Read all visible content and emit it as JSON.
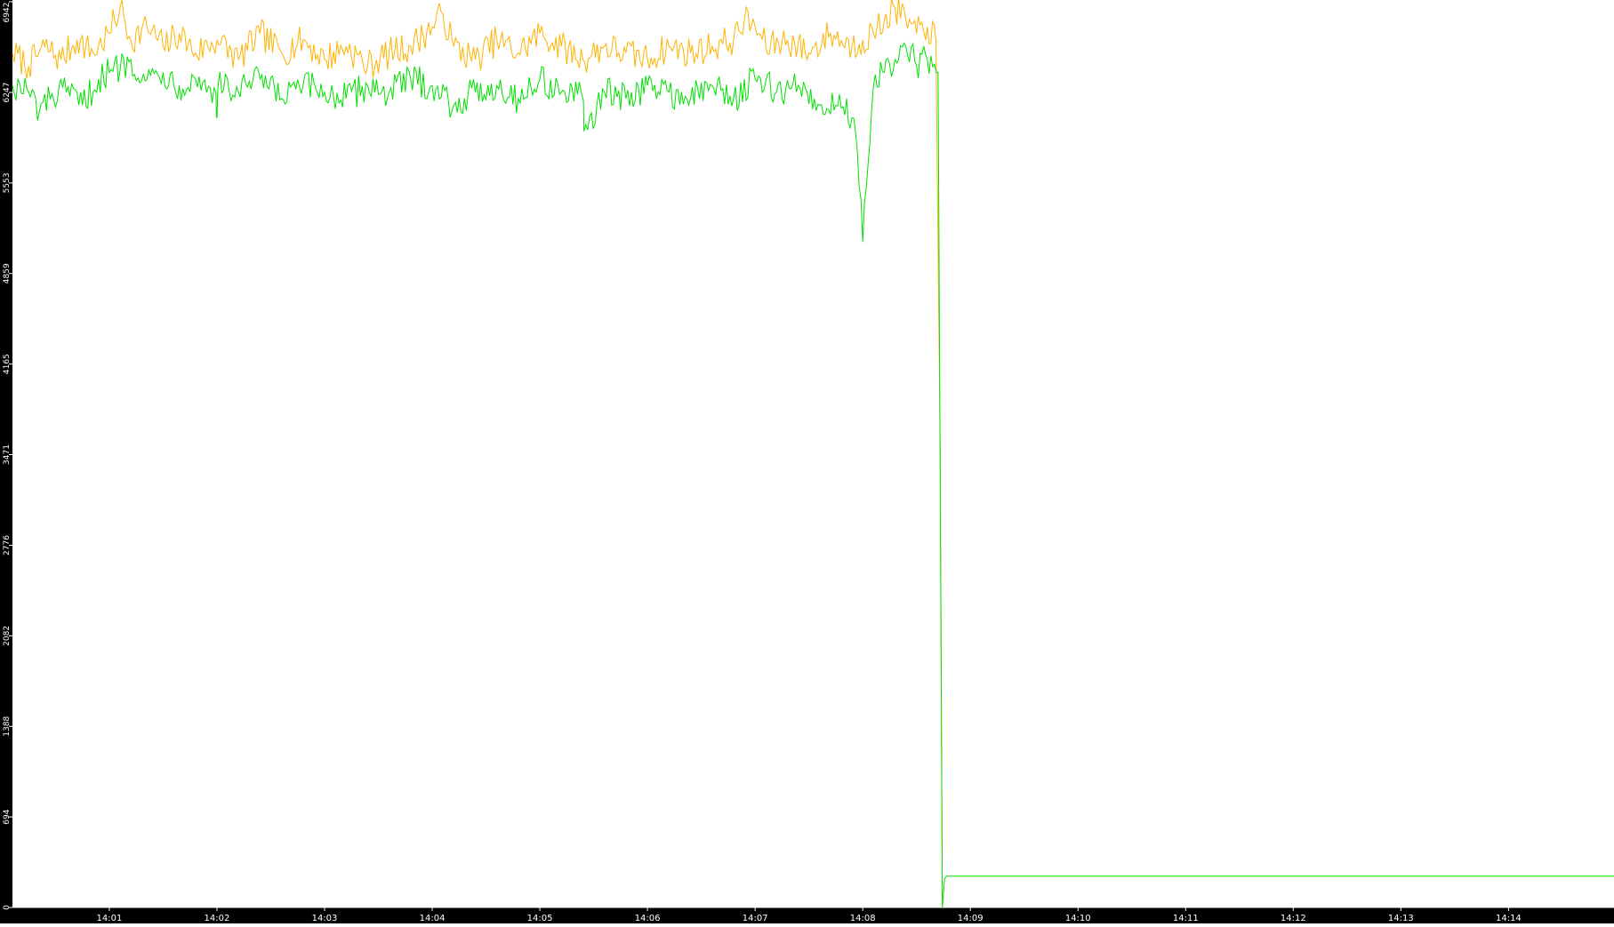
{
  "chart_data": {
    "type": "line",
    "title": "",
    "xlabel": "",
    "ylabel": "",
    "x_tick_labels": [
      "14:01",
      "14:02",
      "14:03",
      "14:04",
      "14:05",
      "14:06",
      "14:07",
      "14:08",
      "14:09",
      "14:10",
      "14:11",
      "14:12",
      "14:13",
      "14:14"
    ],
    "x_tick_minutes": [
      1,
      2,
      3,
      4,
      5,
      6,
      7,
      8,
      9,
      10,
      11,
      12,
      13,
      14
    ],
    "x_range_minutes": [
      0.1,
      14.98
    ],
    "y_tick_labels": [
      "0",
      "694",
      "1388",
      "2082",
      "2776",
      "3471",
      "4165",
      "4859",
      "5553",
      "6247",
      "6942"
    ],
    "y_tick_values": [
      0,
      694,
      1388,
      2082,
      2776,
      3471,
      4165,
      4859,
      5553,
      6247,
      6942
    ],
    "ylim": [
      0,
      6942
    ],
    "grid": false,
    "legend": "none",
    "series": [
      {
        "color": "#ffb300",
        "x": [
          0.1,
          0.25,
          0.4,
          0.55,
          0.7,
          0.85,
          1.0,
          1.1,
          1.2,
          1.35,
          1.5,
          1.65,
          1.8,
          2.0,
          2.2,
          2.4,
          2.6,
          2.8,
          3.0,
          3.2,
          3.4,
          3.6,
          3.8,
          4.0,
          4.1,
          4.2,
          4.4,
          4.6,
          4.8,
          5.0,
          5.2,
          5.4,
          5.6,
          5.8,
          6.0,
          6.2,
          6.4,
          6.6,
          6.8,
          6.9,
          7.0,
          7.1,
          7.3,
          7.5,
          7.7,
          7.9,
          8.0,
          8.1,
          8.2,
          8.3,
          8.4,
          8.5,
          8.6,
          8.68,
          8.72,
          8.74
        ],
        "y": [
          6550,
          6450,
          6600,
          6500,
          6650,
          6550,
          6700,
          6900,
          6650,
          6750,
          6600,
          6700,
          6550,
          6650,
          6500,
          6700,
          6550,
          6650,
          6500,
          6600,
          6450,
          6550,
          6600,
          6750,
          6850,
          6600,
          6500,
          6650,
          6550,
          6700,
          6600,
          6500,
          6600,
          6550,
          6500,
          6600,
          6550,
          6600,
          6650,
          6800,
          6750,
          6600,
          6650,
          6550,
          6700,
          6600,
          6650,
          6700,
          6800,
          6900,
          6800,
          6700,
          6750,
          6650,
          3500,
          0
        ]
      },
      {
        "color": "#00e000",
        "x": [
          0.1,
          0.25,
          0.35,
          0.45,
          0.6,
          0.75,
          0.9,
          1.0,
          1.2,
          1.35,
          1.5,
          1.65,
          1.8,
          1.99,
          2.0,
          2.01,
          2.2,
          2.4,
          2.6,
          2.8,
          3.0,
          3.2,
          3.4,
          3.6,
          3.8,
          4.0,
          4.2,
          4.4,
          4.6,
          4.8,
          5.0,
          5.2,
          5.4,
          5.41,
          5.6,
          5.8,
          6.0,
          6.2,
          6.4,
          6.6,
          6.8,
          7.0,
          7.2,
          7.4,
          7.6,
          7.75,
          7.85,
          7.95,
          8.0,
          8.05,
          8.1,
          8.2,
          8.3,
          8.4,
          8.5,
          8.6,
          8.7,
          8.72,
          8.74,
          8.76,
          8.78,
          14.98
        ],
        "y": [
          6300,
          6250,
          6100,
          6200,
          6250,
          6150,
          6350,
          6400,
          6500,
          6350,
          6400,
          6300,
          6350,
          6250,
          6050,
          6300,
          6250,
          6350,
          6200,
          6300,
          6250,
          6200,
          6300,
          6250,
          6350,
          6300,
          6150,
          6250,
          6300,
          6200,
          6350,
          6250,
          6200,
          5950,
          6250,
          6200,
          6300,
          6250,
          6200,
          6300,
          6200,
          6350,
          6250,
          6300,
          6150,
          6150,
          6200,
          5800,
          5100,
          5700,
          6300,
          6400,
          6500,
          6600,
          6450,
          6500,
          6400,
          3300,
          0,
          220,
          240,
          240
        ]
      }
    ]
  }
}
